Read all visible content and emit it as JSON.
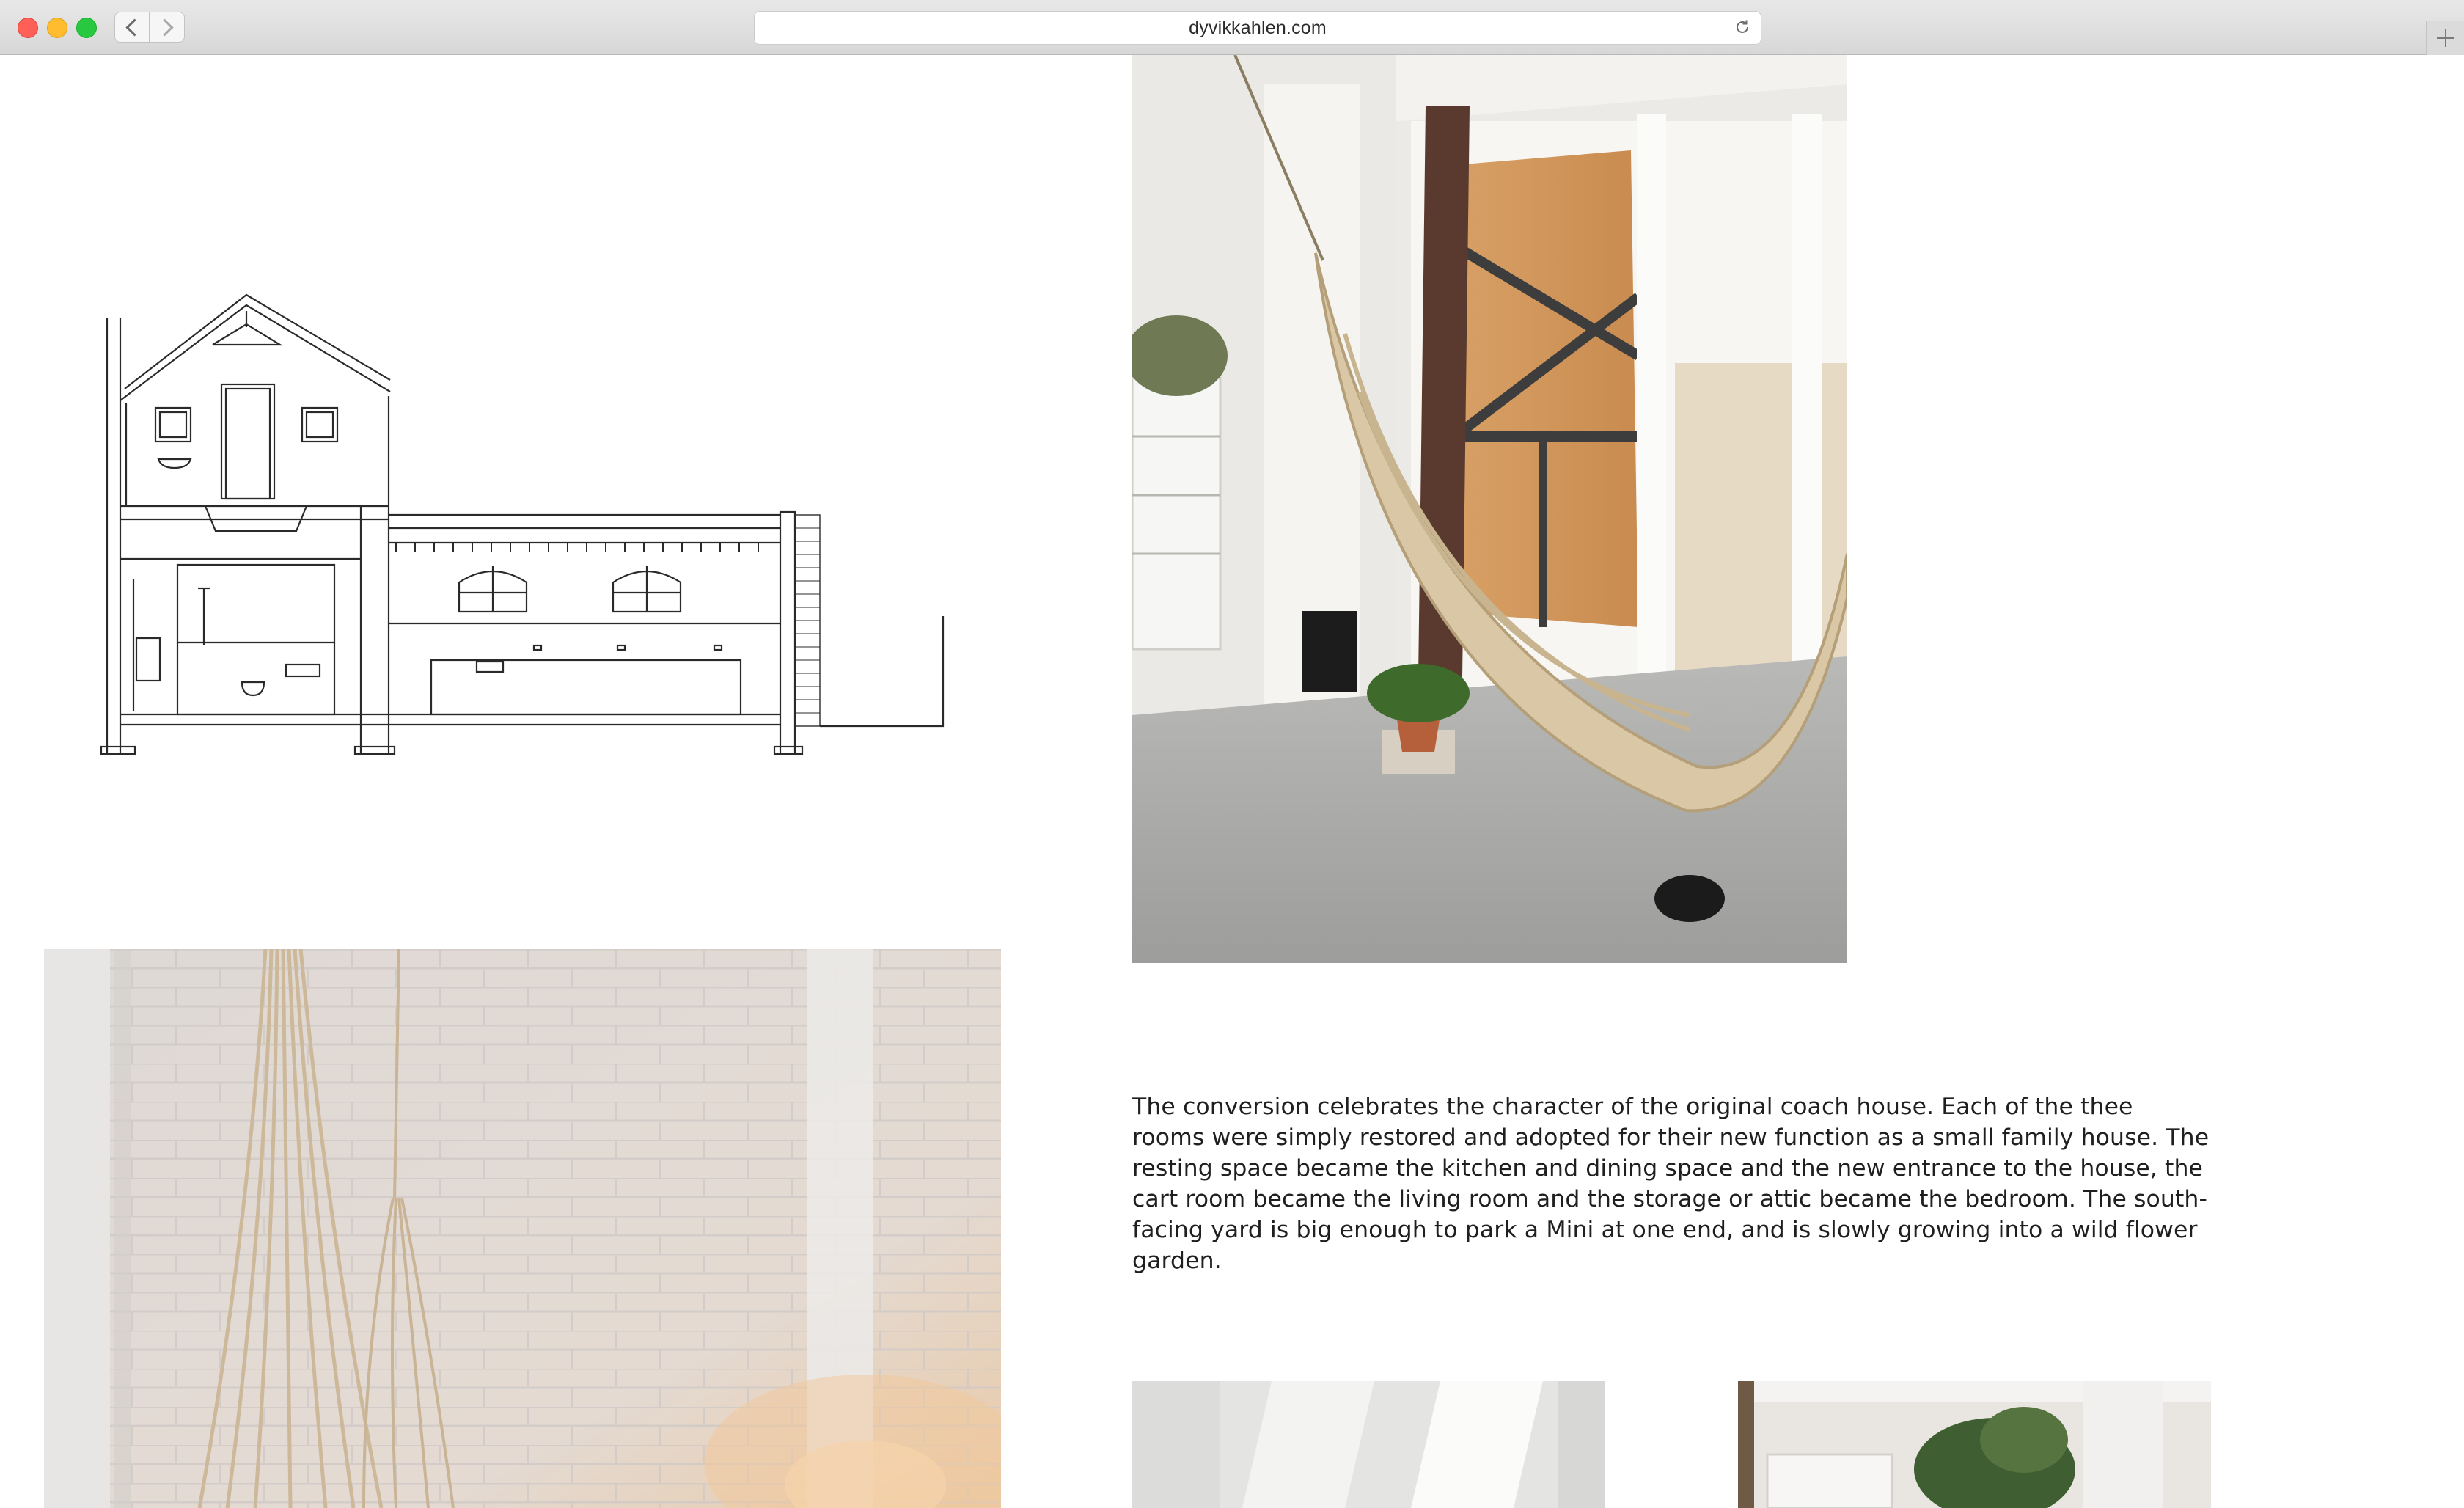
{
  "browser": {
    "url": "dyvikkahlen.com",
    "icons": {
      "back": "chevron-left-icon",
      "forward": "chevron-right-icon",
      "reload": "reload-icon",
      "new_tab": "plus-icon"
    }
  },
  "page": {
    "description": "The conversion celebrates the character of the original coach house. Each of the thee rooms were simply restored and adopted for their new function as a small family house. The resting space became the kitchen and dining space and the new entrance to the house, the cart room became the living room and the storage or attic became the bedroom. The south-facing yard is big enough to park a Mini at one end, and is slowly growing into a wild flower garden."
  },
  "colors": {
    "traffic_close": "#fe5f57",
    "traffic_minimize": "#febc2e",
    "traffic_maximize": "#28c840",
    "text": "#1f1f1f"
  }
}
